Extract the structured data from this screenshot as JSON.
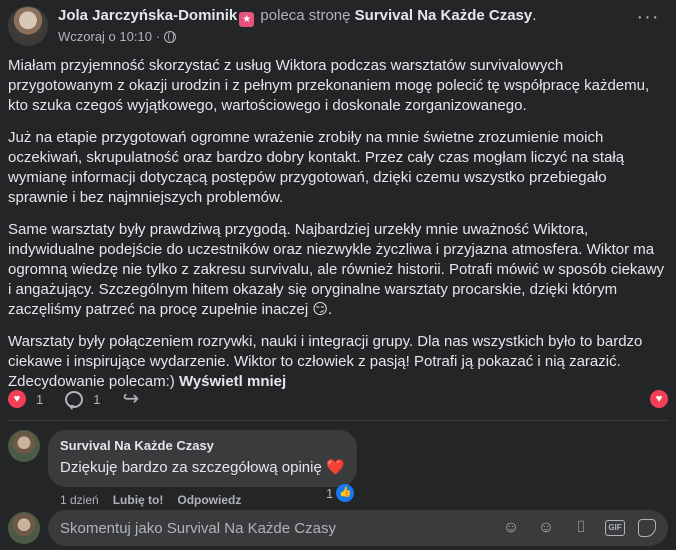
{
  "post": {
    "author": "Jola Jarczyńska-Dominik",
    "verb": "poleca stronę",
    "page": "Survival Na Każde Czasy",
    "period": ".",
    "time": "Wczoraj o 10:10",
    "dot": "·",
    "more": "···",
    "paragraphs": [
      "Miałam przyjemność skorzystać z usług Wiktora podczas warsztatów survivalowych przygotowanym z okazji urodzin i z pełnym przekonaniem mogę polecić tę współpracę każdemu, kto szuka czegoś wyjątkowego, wartościowego i doskonale zorganizowanego.",
      "Już na etapie przygotowań ogromne wrażenie zrobiły na mnie świetne zrozumienie moich oczekiwań, skrupulatność oraz bardzo dobry kontakt. Przez cały czas mogłam liczyć na stałą wymianę informacji dotyczącą postępów przygotowań, dzięki czemu wszystko przebiegało sprawnie i bez najmniejszych problemów.",
      "Same warsztaty były prawdziwą przygodą. Najbardziej urzekły mnie uważność Wiktora, indywidualne podejście do uczestników oraz niezwykle życzliwa i przyjazna atmosfera. Wiktor ma ogromną wiedzę nie tylko z zakresu survivalu, ale również historii. Potrafi mówić w sposób ciekawy i angażujący. Szczególnym hitem okazały się oryginalne warsztaty procarskie, dzięki którym zaczęliśmy patrzeć na procę zupełnie inaczej 😏.",
      "Warsztaty były połączeniem rozrywki, nauki i integracji grupy. Dla nas wszystkich było to bardzo ciekawe i inspirujące wydarzenie. Wiktor to człowiek z pasją! Potrafi ją pokazać i nią zarazić. Zdecydowanie polecam:)"
    ],
    "see_more": "Wyświetl mniej",
    "reaction_count": "1",
    "comment_count": "1"
  },
  "comment": {
    "author": "Survival Na Każde Czasy",
    "text": "Dziękuję bardzo za szczegółową opinię ❤️",
    "age": "1 dzień",
    "like_label": "Lubię to!",
    "reply_label": "Odpowiedz",
    "like_count": "1"
  },
  "reply_box": {
    "placeholder": "Skomentuj jako Survival Na Każde Czasy",
    "gif_label": "GIF"
  },
  "icons": {
    "heart": "♥",
    "share": "↪",
    "like": "👍"
  },
  "colors": {
    "heart": "#f33e58",
    "like": "#1877f2",
    "badge": "#e7537e"
  }
}
